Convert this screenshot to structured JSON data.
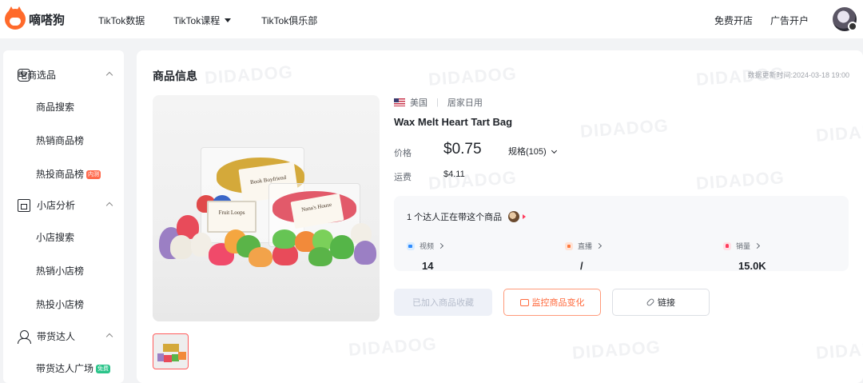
{
  "header": {
    "logo_text": "嘀嗒狗",
    "nav": [
      {
        "label": "TikTok数据"
      },
      {
        "label": "TikTok课程"
      },
      {
        "label": "TikTok俱乐部"
      }
    ],
    "right": [
      {
        "label": "免费开店"
      },
      {
        "label": "广告开户"
      }
    ]
  },
  "sidebar": {
    "sections": [
      {
        "label": "电商选品",
        "icon": "shopping-bag-icon",
        "items": [
          {
            "label": "商品搜索"
          },
          {
            "label": "热销商品榜"
          },
          {
            "label": "热投商品榜",
            "tag": "内测"
          }
        ]
      },
      {
        "label": "小店分析",
        "icon": "shop-icon",
        "items": [
          {
            "label": "小店搜索"
          },
          {
            "label": "热销小店榜"
          },
          {
            "label": "热投小店榜"
          }
        ]
      },
      {
        "label": "带货达人",
        "icon": "person-icon",
        "items": [
          {
            "label": "带货达人广场",
            "tag": "免费"
          }
        ]
      }
    ]
  },
  "product": {
    "section_title": "商品信息",
    "update_time": "数据更新时间:2024-03-18 19:00",
    "region": "美国",
    "category": "居家日用",
    "name": "Wax Melt Heart Tart Bag",
    "price_label": "价格",
    "price": "$0.75",
    "spec": "规格(105)",
    "shipping_label": "运费",
    "shipping": "$4.11",
    "creators_text": "1 个达人正在带这个商品",
    "stats": [
      {
        "label": "视频",
        "value": "14",
        "icon": "video-icon"
      },
      {
        "label": "直播",
        "value": "/",
        "icon": "live-icon"
      },
      {
        "label": "销量",
        "value": "15.0K",
        "icon": "sales-icon"
      }
    ],
    "buttons": {
      "favorited": "已加入商品收藏",
      "monitor": "监控商品变化",
      "link": "链接"
    },
    "image_labels": {
      "card1": "Book Boyfriend",
      "card2": "Nana's House",
      "card3": "Fruit Loops"
    }
  },
  "watermark": "DIDADOG",
  "colors": {
    "accent": "#ff6a3d",
    "thumb_border": "#ff5c5c",
    "tag_red": "#ff6a4d",
    "tag_green": "#2bc48a"
  }
}
